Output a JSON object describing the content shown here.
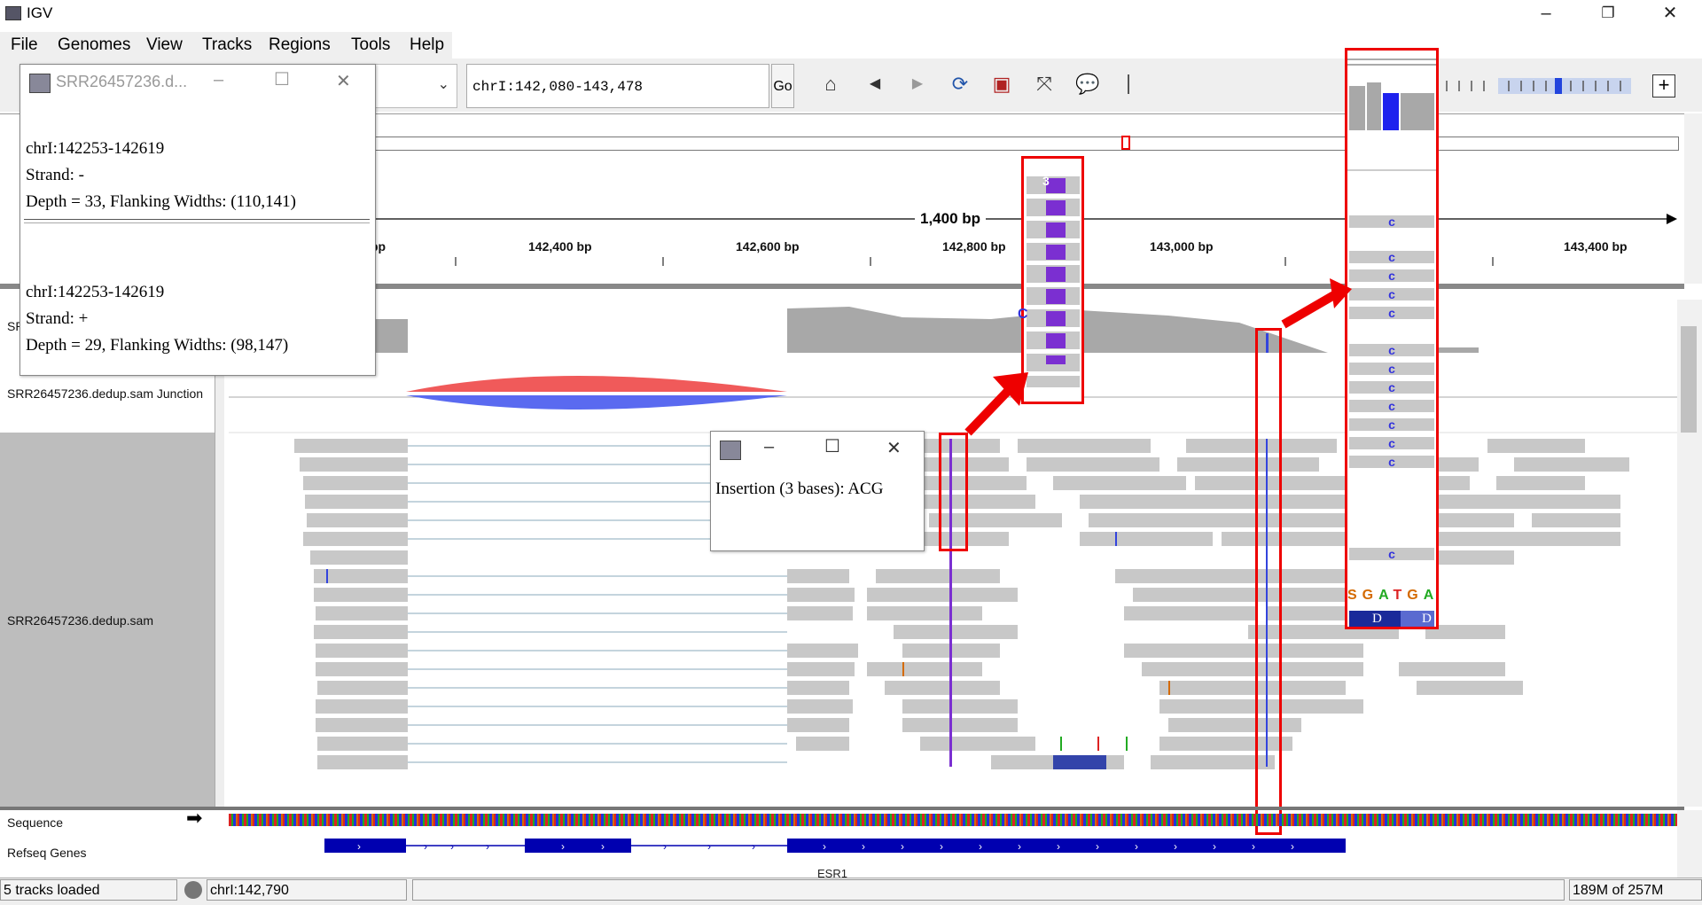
{
  "window": {
    "title": "IGV",
    "minimize": "–",
    "restore": "❐",
    "close": "✕"
  },
  "menu": [
    "File",
    "Genomes",
    "View",
    "Tracks",
    "Regions",
    "Tools",
    "Help"
  ],
  "toolbar": {
    "locus": "chrI:142,080-143,478",
    "go": "Go"
  },
  "ruler": {
    "span": "1,400 bp",
    "ticks": [
      "bp",
      "142,400 bp",
      "142,600 bp",
      "142,800 bp",
      "143,000 bp",
      "143,400 bp"
    ]
  },
  "tracks": {
    "coverage": "SR",
    "junction": "SRR26457236.dedup.sam Junction",
    "alignment": "SRR26457236.dedup.sam",
    "sequence": "Sequence",
    "genes": "Refseq Genes",
    "gene_label": "ESR1"
  },
  "popup_junction": {
    "title": "SRR26457236.d...",
    "e1_loc": "chrI:142253-142619",
    "e1_strand": "Strand: -",
    "e1_depth": "Depth = 33, Flanking Widths: (110,141)",
    "e2_loc": "chrI:142253-142619",
    "e2_strand": "Strand: +",
    "e2_depth": "Depth = 29, Flanking Widths: (98,147)"
  },
  "popup_insertion": {
    "text": "Insertion (3 bases): ACG"
  },
  "zoom_insert": {
    "bases": [
      "G",
      "A",
      "T",
      "G",
      "A"
    ],
    "base_prefix": "S",
    "deletion": [
      "D",
      "D"
    ],
    "mismatch_base": "C",
    "insertion_count": "3"
  },
  "status": {
    "left": "5 tracks loaded",
    "locus": "chrI:142,790",
    "memory": "189M of 257M"
  },
  "colors": {
    "accent_red": "#e00000",
    "insertion_purple": "#7b2fd1",
    "read_gray": "#c8c8c8",
    "junction_red": "#f05a5a",
    "junction_blue": "#5a6af0",
    "gene_blue": "#0000b0"
  }
}
